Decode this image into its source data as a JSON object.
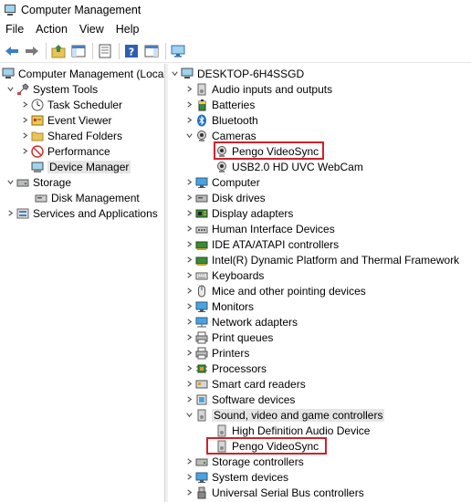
{
  "window": {
    "title": "Computer Management"
  },
  "menu": [
    "File",
    "Action",
    "View",
    "Help"
  ],
  "left_tree": [
    {
      "label": "Computer Management (Local",
      "icon": "computer-management-icon"
    },
    {
      "label": "System Tools",
      "icon": "system-tools-icon"
    },
    {
      "label": "Task Scheduler",
      "icon": "clock-icon"
    },
    {
      "label": "Event Viewer",
      "icon": "event-viewer-icon"
    },
    {
      "label": "Shared Folders",
      "icon": "folder-icon"
    },
    {
      "label": "Performance",
      "icon": "performance-icon"
    },
    {
      "label": "Device Manager",
      "icon": "device-manager-icon"
    },
    {
      "label": "Storage",
      "icon": "storage-icon"
    },
    {
      "label": "Disk Management",
      "icon": "disk-icon"
    },
    {
      "label": "Services and Applications",
      "icon": "services-icon"
    }
  ],
  "device_tree": {
    "root": "DESKTOP-6H4SSGD",
    "items": [
      {
        "label": "Audio inputs and outputs",
        "icon": "speaker-icon"
      },
      {
        "label": "Batteries",
        "icon": "battery-icon"
      },
      {
        "label": "Bluetooth",
        "icon": "bluetooth-icon"
      },
      {
        "label": "Cameras",
        "icon": "camera-icon"
      },
      {
        "label": "Pengo VideoSync",
        "icon": "camera-icon"
      },
      {
        "label": "USB2.0 HD UVC WebCam",
        "icon": "camera-icon"
      },
      {
        "label": "Computer",
        "icon": "monitor-icon"
      },
      {
        "label": "Disk drives",
        "icon": "disk-drive-icon"
      },
      {
        "label": "Display adapters",
        "icon": "display-adapter-icon"
      },
      {
        "label": "Human Interface Devices",
        "icon": "hid-icon"
      },
      {
        "label": "IDE ATA/ATAPI controllers",
        "icon": "controller-icon"
      },
      {
        "label": "Intel(R) Dynamic Platform and Thermal Framework",
        "icon": "controller-icon"
      },
      {
        "label": "Keyboards",
        "icon": "keyboard-icon"
      },
      {
        "label": "Mice and other pointing devices",
        "icon": "mouse-icon"
      },
      {
        "label": "Monitors",
        "icon": "monitor-icon"
      },
      {
        "label": "Network adapters",
        "icon": "network-icon"
      },
      {
        "label": "Print queues",
        "icon": "printer-icon"
      },
      {
        "label": "Printers",
        "icon": "printer-icon"
      },
      {
        "label": "Processors",
        "icon": "processor-icon"
      },
      {
        "label": "Smart card readers",
        "icon": "smart-card-icon"
      },
      {
        "label": "Software devices",
        "icon": "software-device-icon"
      },
      {
        "label": "Sound, video and game controllers",
        "icon": "speaker-icon"
      },
      {
        "label": "High Definition Audio Device",
        "icon": "speaker-icon"
      },
      {
        "label": "Pengo VideoSync",
        "icon": "speaker-icon"
      },
      {
        "label": "Storage controllers",
        "icon": "storage-controller-icon"
      },
      {
        "label": "System devices",
        "icon": "system-device-icon"
      },
      {
        "label": "Universal Serial Bus controllers",
        "icon": "usb-icon"
      }
    ]
  },
  "colors": {
    "highlight_box": "#d0212b",
    "selection": "#e5e5e5"
  }
}
